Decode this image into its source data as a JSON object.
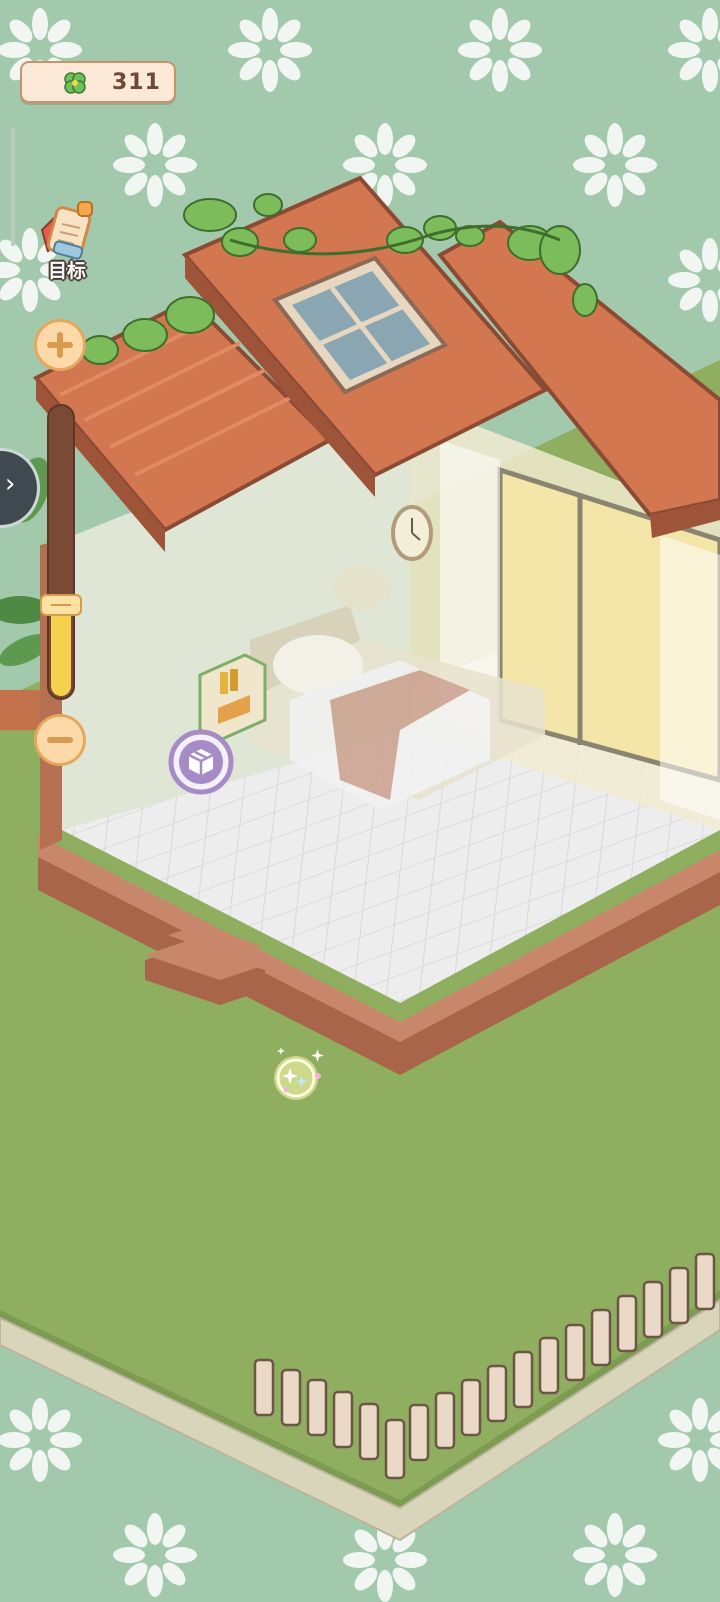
{
  "hud": {
    "currency_amount": "311",
    "currency_icon": "four-leaf-clover-icon",
    "goal_label": "目标",
    "goal_icon": "quest-scroll-icon",
    "zoom_in_icon": "plus-icon",
    "zoom_out_icon": "minus-icon",
    "expand_icon": "chevron-right-icon",
    "zoom_level": 0.32
  },
  "room": {
    "store_icon": "storage-box-icon",
    "reward_icon": "sparkle-icon"
  },
  "colors": {
    "background": "#a3c9ad",
    "lawn": "#8fae5f",
    "roof": "#d2774f",
    "accent": "#e6a75d"
  }
}
